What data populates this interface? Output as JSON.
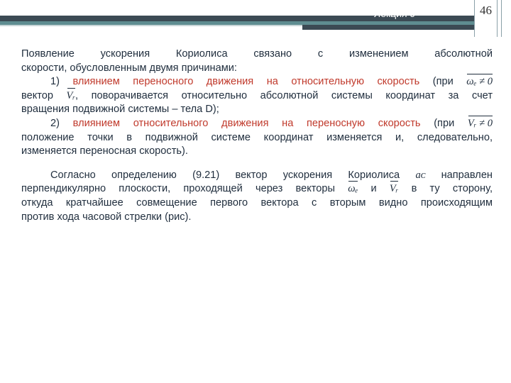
{
  "header": {
    "title": "Лекция 9",
    "page_number": "46"
  },
  "paragraphs": {
    "p1_line1": "Появление ускорения Кориолиса связано с изменением абсолютной",
    "p1_line2": "скорости, обусловленным двумя причинами:",
    "item1_num": "1) ",
    "item1_hl": "влиянием переносного движения на относительную скорость",
    "item1_rest": " (при ",
    "item1_cond": "ωₑ ≠ 0",
    "item1_line2": "вектор ",
    "item1_line2_rest": ", поворачивается относительно абсолютной системы координат за счет",
    "item1_line3": "вращения подвижной системы – тела D);",
    "item2_num": "2) ",
    "item2_hl": "влиянием относительного движения на переносную скорость",
    "item2_rest": " (при ",
    "item2_cond": "Vᵣ ≠ 0",
    "item2_line2": "положение точки в подвижной системе координат изменяется и, следовательно,",
    "item2_line3": "изменяется переносная скорость).",
    "p2_line1": "Согласно определению (9.21) вектор ускорения Кориолиса",
    "p2_line1_end": " направлен",
    "p2_line2_a": "перпендикулярно плоскости, проходящей через векторы",
    "p2_line2_and": " и ",
    "p2_line2_b": " в ту сторону,",
    "p2_line3": "откуда кратчайшее совмещение первого вектора с вторым видно происходящим",
    "p2_line4": "против хода часовой стрелки (рис)."
  },
  "symbols": {
    "vr": "Vᵣ",
    "omega_e": "ωₑ",
    "ac": "aᴄ"
  }
}
